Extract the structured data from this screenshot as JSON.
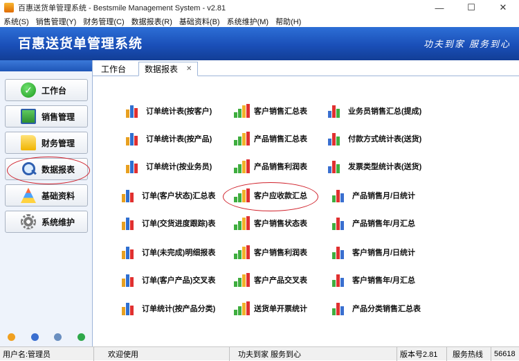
{
  "window": {
    "title": "百惠送货单管理系统 - Bestsmile Management System - v2.81",
    "minimize": "—",
    "maximize": "☐",
    "close": "✕"
  },
  "menu": [
    "系统(S)",
    "销售管理(Y)",
    "财务管理(C)",
    "数据报表(R)",
    "基础资料(B)",
    "系统维护(M)",
    "帮助(H)"
  ],
  "banner": {
    "title": "百惠送货单管理系统",
    "slogan": "功夫到家 服务到心"
  },
  "sidebar": {
    "items": [
      {
        "label": "工作台",
        "icon": "check-icon"
      },
      {
        "label": "销售管理",
        "icon": "window-icon"
      },
      {
        "label": "财务管理",
        "icon": "folder-icon"
      },
      {
        "label": "数据报表",
        "icon": "search-icon"
      },
      {
        "label": "基础资料",
        "icon": "pyramid-icon"
      },
      {
        "label": "系统维护",
        "icon": "gear-icon"
      }
    ],
    "bottom_icons": [
      "folder-small-icon",
      "info-icon",
      "search-small-icon",
      "refresh-icon"
    ]
  },
  "tabs": {
    "work": "工作台",
    "report": "数据报表",
    "close": "✕"
  },
  "reports": {
    "col1": [
      "订单统计表(按客户)",
      "订单统计表(按产品)",
      "订单统计(按业务员)",
      "订单(客户状态)汇总表",
      "订单(交货进度跟踪)表",
      "订单(未完成)明细报表",
      "订单(客户产品)交叉表",
      "订单统计(按产品分类)"
    ],
    "col2": [
      "客户销售汇总表",
      "产品销售汇总表",
      "产品销售利润表",
      "客户应收款汇总",
      "客户销售状态表",
      "客户销售利润表",
      "客户产品交叉表",
      "送货单开票统计"
    ],
    "col3": [
      "业务员销售汇总(提成)",
      "付款方式统计表(送货)",
      "发票类型统计表(送货)",
      "产品销售月/日统计",
      "产品销售年/月汇总",
      "客户销售月/日统计",
      "客户销售年/月汇总",
      "产品分类销售汇总表"
    ]
  },
  "status": {
    "user": "用户名:管理员",
    "welcome": "欢迎使用",
    "slogan": "功夫到家 服务到心",
    "version": "版本号2.81",
    "service": "服务热线",
    "phone": "56618"
  },
  "colors": {
    "banner": "#1a4fb8",
    "highlight": "#d0202a"
  }
}
